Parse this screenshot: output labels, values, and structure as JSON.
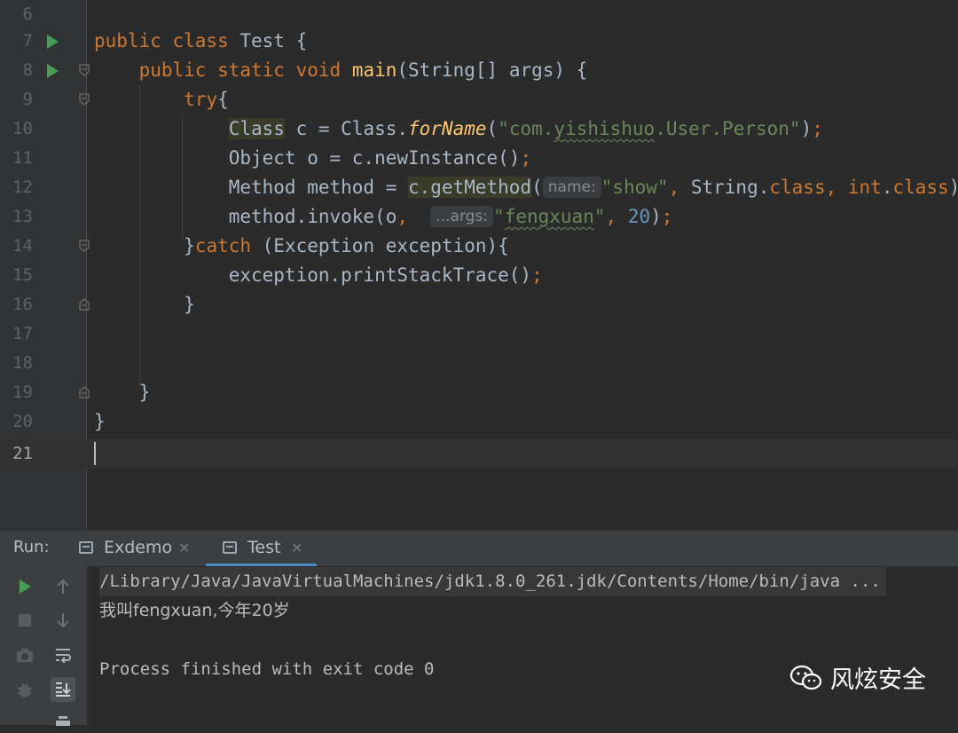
{
  "editor": {
    "lines": [
      {
        "num": "6",
        "code": ""
      },
      {
        "num": "7",
        "code": "public class Test {"
      },
      {
        "num": "8",
        "code": "    public static void main(String[] args) {"
      },
      {
        "num": "9",
        "code": "        try{"
      },
      {
        "num": "10",
        "code": "            Class c = Class.forName(\"com.yishishuo.User.Person\");"
      },
      {
        "num": "11",
        "code": "            Object o = c.newInstance();"
      },
      {
        "num": "12",
        "code": "            Method method = c.getMethod( name: \"show\", String.class, int.class);"
      },
      {
        "num": "13",
        "code": "            method.invoke(o,  ...args: \"fengxuan\", 20);"
      },
      {
        "num": "14",
        "code": "        }catch (Exception exception){"
      },
      {
        "num": "15",
        "code": "            exception.printStackTrace();"
      },
      {
        "num": "16",
        "code": "        }"
      },
      {
        "num": "17",
        "code": ""
      },
      {
        "num": "18",
        "code": ""
      },
      {
        "num": "19",
        "code": "    }"
      },
      {
        "num": "20",
        "code": "}"
      },
      {
        "num": "21",
        "code": ""
      }
    ],
    "hints": {
      "name": "name:",
      "args": "...args:"
    }
  },
  "run_panel": {
    "label": "Run:",
    "tabs": [
      {
        "label": "Exdemo",
        "active": false
      },
      {
        "label": "Test",
        "active": true
      }
    ],
    "console": [
      "/Library/Java/JavaVirtualMachines/jdk1.8.0_261.jdk/Contents/Home/bin/java ...",
      "我叫fengxuan,今年20岁",
      "",
      "Process finished with exit code 0"
    ]
  },
  "watermark": {
    "text": "风炫安全"
  },
  "colors": {
    "keyword": "#cc7832",
    "function": "#ffc66d",
    "string": "#6a8759",
    "number": "#6897bb",
    "text": "#a9b7c6",
    "run": "#499c54"
  }
}
